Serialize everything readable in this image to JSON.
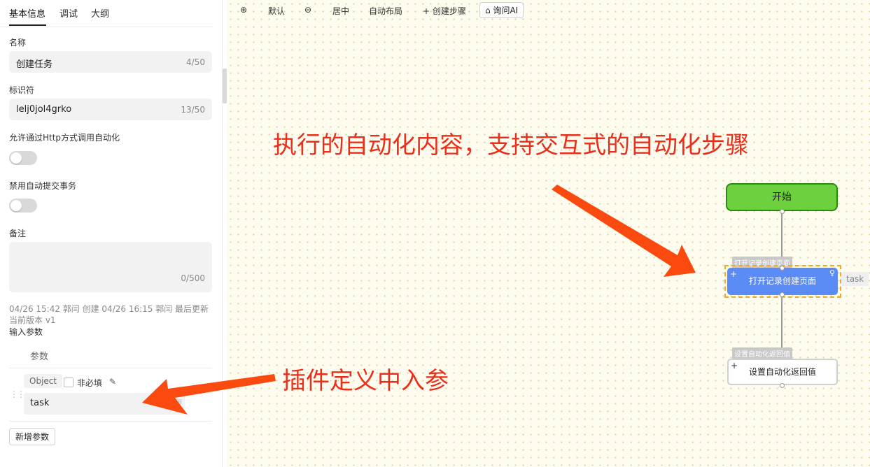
{
  "tabs": [
    {
      "label": "基本信息",
      "active": true
    },
    {
      "label": "调试",
      "active": false
    },
    {
      "label": "大纲",
      "active": false
    }
  ],
  "form": {
    "name_label": "名称",
    "name_value": "创建任务",
    "name_count": "4/50",
    "id_label": "标识符",
    "id_value": "lelj0jol4grko",
    "id_count": "13/50",
    "http_label": "允许通过Http方式调用自动化",
    "http_enabled": false,
    "tx_label": "禁用自动提交事务",
    "tx_enabled": false,
    "note_label": "备注",
    "note_value": "",
    "note_count": "0/500"
  },
  "meta_text": "04/26 15:42 郭闫 创建 04/26 16:15 郭闫 最后更新 当前版本 v1",
  "params": {
    "section_label": "输入参数",
    "column_header": "参数",
    "rows": [
      {
        "type": "Object",
        "optional_label": "非必填",
        "name": "task"
      }
    ],
    "add_label": "新增参数"
  },
  "toolbar": {
    "zoom_in_icon": "zoom-in-icon",
    "default_label": "默认",
    "zoom_out_icon": "zoom-out-icon",
    "center_label": "居中",
    "auto_layout_label": "自动布局",
    "create_step_label": "+ 创建步骤",
    "ask_ai_label": "询问AI"
  },
  "annotations": {
    "top": "执行的自动化内容，支持交互式的自动化步骤",
    "bottom": "插件定义中入参",
    "color": "#e8301d"
  },
  "flow": {
    "start_label": "开始",
    "open_step_tag": "打开记录创建页面",
    "open_step_label": "打开记录创建页面",
    "open_step_chip": "task",
    "return_step_tag": "设置自动化返回值",
    "return_step_label": "设置自动化返回值"
  }
}
